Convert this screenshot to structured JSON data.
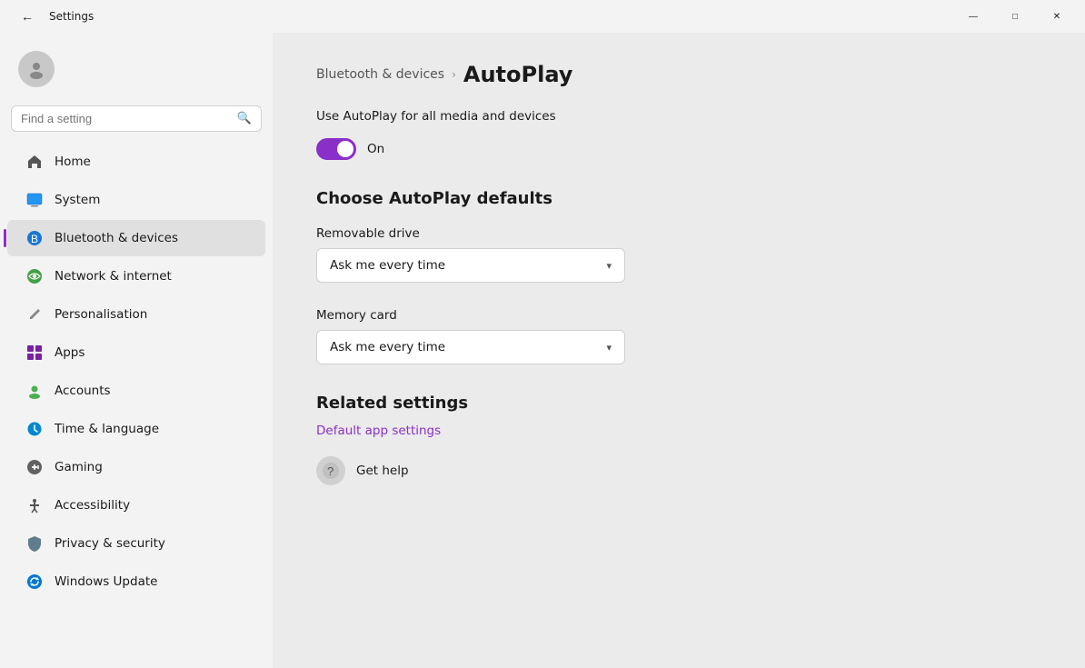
{
  "titlebar": {
    "title": "Settings",
    "minimize_label": "—",
    "maximize_label": "□",
    "close_label": "✕"
  },
  "sidebar": {
    "search_placeholder": "Find a setting",
    "nav_items": [
      {
        "id": "home",
        "label": "Home",
        "icon": "🏠",
        "active": false
      },
      {
        "id": "system",
        "label": "System",
        "icon": "💻",
        "active": false
      },
      {
        "id": "bluetooth",
        "label": "Bluetooth & devices",
        "icon": "🔵",
        "active": true
      },
      {
        "id": "network",
        "label": "Network & internet",
        "icon": "🌐",
        "active": false
      },
      {
        "id": "personalisation",
        "label": "Personalisation",
        "icon": "✏️",
        "active": false
      },
      {
        "id": "apps",
        "label": "Apps",
        "icon": "🟪",
        "active": false
      },
      {
        "id": "accounts",
        "label": "Accounts",
        "icon": "🟢",
        "active": false
      },
      {
        "id": "time",
        "label": "Time & language",
        "icon": "🌐",
        "active": false
      },
      {
        "id": "gaming",
        "label": "Gaming",
        "icon": "🎮",
        "active": false
      },
      {
        "id": "accessibility",
        "label": "Accessibility",
        "icon": "♿",
        "active": false
      },
      {
        "id": "privacy",
        "label": "Privacy & security",
        "icon": "🛡️",
        "active": false
      },
      {
        "id": "update",
        "label": "Windows Update",
        "icon": "🔄",
        "active": false
      }
    ]
  },
  "main": {
    "breadcrumb_parent": "Bluetooth & devices",
    "breadcrumb_separator": "›",
    "page_title": "AutoPlay",
    "autoplay_desc": "Use AutoPlay for all media and devices",
    "toggle_state": "On",
    "choose_title": "Choose AutoPlay defaults",
    "removable_drive_label": "Removable drive",
    "removable_drive_value": "Ask me every time",
    "memory_card_label": "Memory card",
    "memory_card_value": "Ask me every time",
    "related_title": "Related settings",
    "related_link": "Default app settings",
    "help_link": "Get help"
  },
  "colors": {
    "accent": "#8b2fc9",
    "toggle_bg": "#8b2fc9"
  }
}
